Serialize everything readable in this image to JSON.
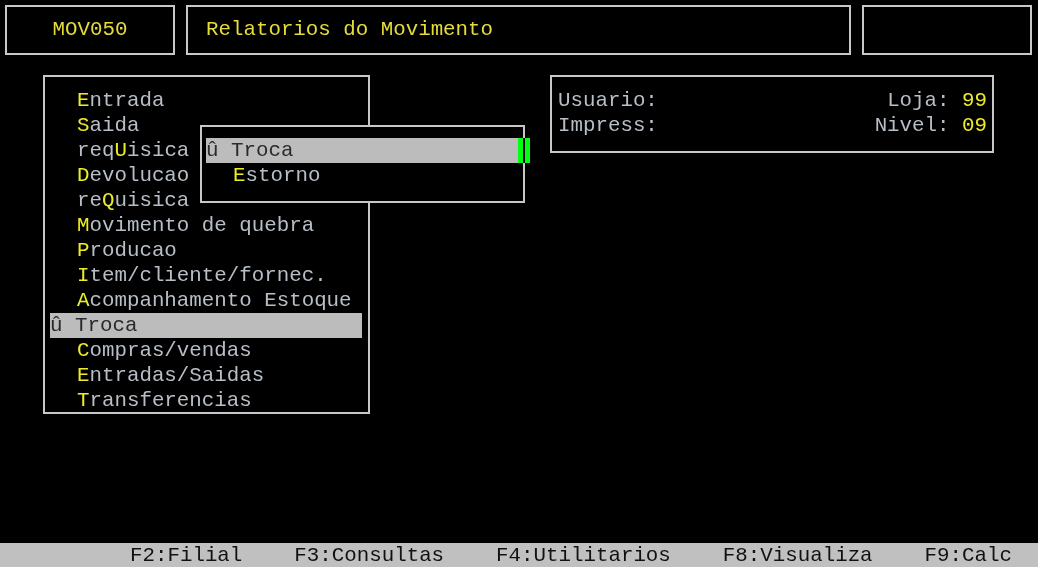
{
  "header": {
    "program_code": "MOV050",
    "title": "Relatorios do Movimento"
  },
  "menu": {
    "items": [
      {
        "hotkey": "E",
        "after": "ntrada",
        "selected": false
      },
      {
        "hotkey": "S",
        "after": "aida",
        "selected": false
      },
      {
        "before": "req",
        "hotkey": "U",
        "after": "isica",
        "selected": false
      },
      {
        "hotkey": "D",
        "after": "evolucao",
        "selected": false
      },
      {
        "before": "re",
        "hotkey": "Q",
        "after": "uisica",
        "selected": false
      },
      {
        "hotkey": "M",
        "after": "ovimento de quebra",
        "selected": false
      },
      {
        "hotkey": "P",
        "after": "roducao",
        "selected": false
      },
      {
        "hotkey": "I",
        "after": "tem/cliente/fornec.",
        "selected": false
      },
      {
        "hotkey": "A",
        "after": "companhamento Estoque",
        "selected": false
      },
      {
        "before": "û Troca",
        "selected": true
      },
      {
        "hotkey": "C",
        "after": "ompras/vendas",
        "selected": false
      },
      {
        "hotkey": "E",
        "after": "ntradas/Saidas",
        "selected": false
      },
      {
        "hotkey": "T",
        "after": "ransferencias",
        "selected": false
      }
    ]
  },
  "submenu": {
    "items": [
      {
        "before": "û Troca",
        "selected": true
      },
      {
        "hotkey": "E",
        "after": "storno",
        "selected": false
      }
    ]
  },
  "info": {
    "rows": [
      {
        "label": "Usuario:",
        "right_label": "Loja:",
        "right_value": "99"
      },
      {
        "label": "Impress:",
        "right_label": "Nivel:",
        "right_value": "09"
      }
    ]
  },
  "status_bar": [
    "F2:Filial",
    "F3:Consultas",
    "F4:Utilitarios",
    "F8:Visualiza",
    "F9:Calc"
  ]
}
